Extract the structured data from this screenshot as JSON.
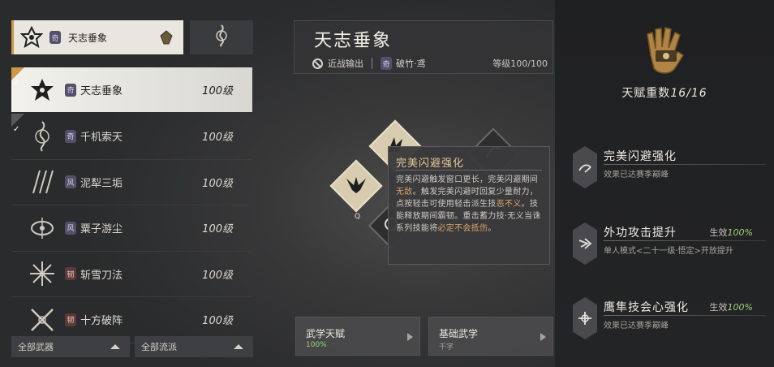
{
  "header": {
    "current_weapon_label": "天志垂象"
  },
  "weapons": [
    {
      "name": "天志垂象",
      "level": "100级",
      "badge": "奇",
      "active": true,
      "checked": true
    },
    {
      "name": "千机索天",
      "level": "100级",
      "badge": "奇",
      "active": false,
      "checked": true
    },
    {
      "name": "泥犁三垢",
      "level": "100级",
      "badge": "风",
      "active": false,
      "checked": false
    },
    {
      "name": "粟子游尘",
      "level": "100级",
      "badge": "风",
      "active": false,
      "checked": false
    },
    {
      "name": "斩雪刀法",
      "level": "100级",
      "badge": "韧",
      "active": false,
      "checked": false
    },
    {
      "name": "十方破阵",
      "level": "100级",
      "badge": "韧",
      "active": false,
      "checked": false
    }
  ],
  "filters": {
    "weapon": "全部武器",
    "style": "全部流派"
  },
  "detail": {
    "title": "天志垂象",
    "role": "近战输出",
    "school_badge": "奇",
    "school": "破竹·鸢",
    "level": "等级100/100"
  },
  "skill_key": "Q",
  "tooltip": {
    "title": "完美闪避强化",
    "body_1": "完美闪避触发窗口更长，完美闪避期间",
    "body_hl_1": "无敌",
    "body_2": "。触发完美闪避时回复少量耐力，点按轻击可使用轻击派生技",
    "body_hl_2": "恶不义",
    "body_3": "。技能释放期间霸韧。重击蓄力技·无义当诛系列技能将",
    "body_hl_3": "必定不会抵伤",
    "body_4": "。"
  },
  "bottom_tabs": [
    {
      "title": "武学天赋",
      "subtitle": "100%"
    },
    {
      "title": "基础武学",
      "subtitle": "千字"
    }
  ],
  "talent": {
    "count_label": "天赋重数",
    "count": "16/16"
  },
  "talents": [
    {
      "name": "完美闪避强化",
      "status_label": "",
      "status_pct": "",
      "desc": "效果已达赛季巅峰"
    },
    {
      "name": "外功攻击提升",
      "status_label": "生效",
      "status_pct": "100%",
      "desc": "单人模式<二十一级·悟定>开放提升"
    },
    {
      "name": "鹰隼技会心强化",
      "status_label": "生效",
      "status_pct": "100%",
      "desc": "效果已达赛季巅峰"
    }
  ],
  "colors": {
    "accent_gold": "#c89a4a",
    "effect_green": "#9fd37a",
    "highlight_orange": "#d9a46a"
  }
}
